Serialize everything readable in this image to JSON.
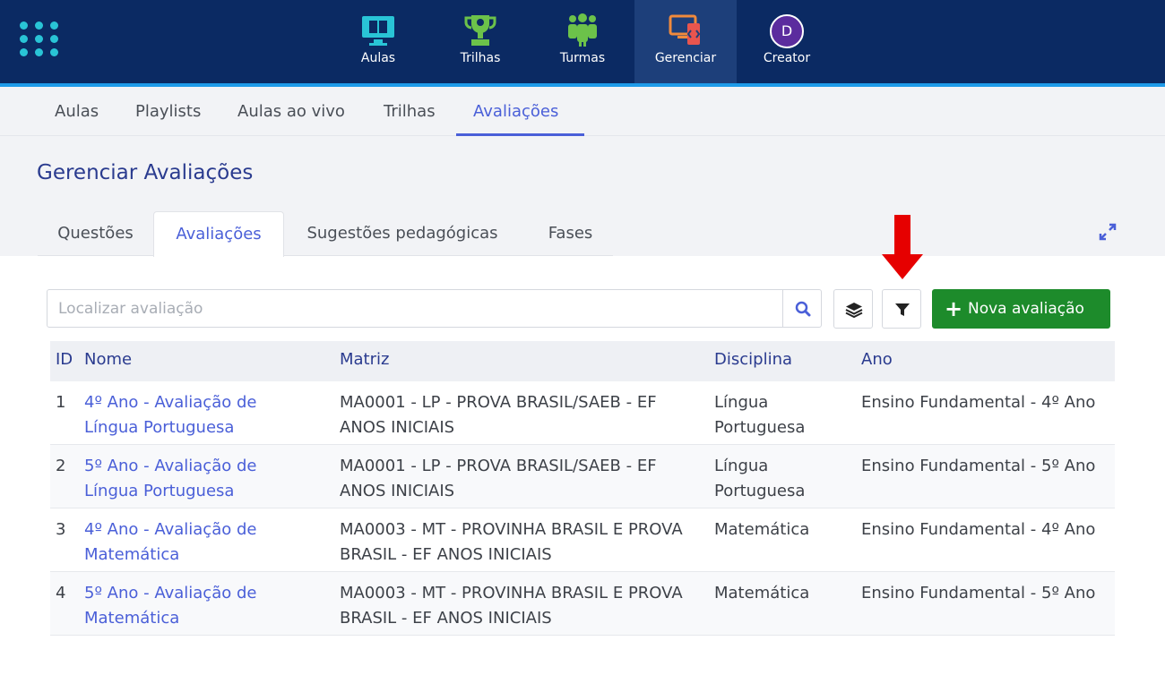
{
  "topnav": {
    "items": [
      {
        "label": "Aulas"
      },
      {
        "label": "Trilhas"
      },
      {
        "label": "Turmas"
      },
      {
        "label": "Gerenciar"
      },
      {
        "label": "Creator",
        "avatar_letter": "D"
      }
    ]
  },
  "subnav": {
    "items": [
      {
        "label": "Aulas"
      },
      {
        "label": "Playlists"
      },
      {
        "label": "Aulas ao vivo"
      },
      {
        "label": "Trilhas"
      },
      {
        "label": "Avaliações"
      }
    ]
  },
  "page": {
    "title": "Gerenciar Avaliações",
    "tabs": [
      {
        "label": "Questões"
      },
      {
        "label": "Avaliações"
      },
      {
        "label": "Sugestões pedagógicas"
      },
      {
        "label": "Fases"
      }
    ]
  },
  "toolbar": {
    "search_placeholder": "Localizar avaliação",
    "new_button_label": "Nova avaliação"
  },
  "table": {
    "headers": {
      "id": "ID",
      "nome": "Nome",
      "matriz": "Matriz",
      "disciplina": "Disciplina",
      "ano": "Ano"
    },
    "rows": [
      {
        "id": "1",
        "nome": "4º Ano - Avaliação de Língua Portuguesa",
        "matriz": "MA0001 - LP - PROVA BRASIL/SAEB - EF ANOS INICIAIS",
        "disciplina": "Língua Portuguesa",
        "ano": "Ensino Fundamental - 4º Ano"
      },
      {
        "id": "2",
        "nome": "5º Ano - Avaliação de Língua Portuguesa",
        "matriz": "MA0001 - LP - PROVA BRASIL/SAEB - EF ANOS INICIAIS",
        "disciplina": "Língua Portuguesa",
        "ano": "Ensino Fundamental - 5º Ano"
      },
      {
        "id": "3",
        "nome": "4º Ano - Avaliação de Matemática",
        "matriz": "MA0003 - MT - PROVINHA BRASIL E PROVA BRASIL - EF ANOS INICIAIS",
        "disciplina": "Matemática",
        "ano": "Ensino Fundamental - 4º Ano"
      },
      {
        "id": "4",
        "nome": "5º Ano - Avaliação de Matemática",
        "matriz": "MA0003 - MT - PROVINHA BRASIL E PROVA BRASIL - EF ANOS INICIAIS",
        "disciplina": "Matemática",
        "ano": "Ensino Fundamental - 5º Ano"
      }
    ]
  },
  "icons": {
    "apps": "grid-dots-icon",
    "aulas": "monitor-book-icon",
    "trilhas": "trophy-icon",
    "turmas": "people-icon",
    "gerenciar": "devices-icon",
    "expand": "expand-arrows-icon",
    "search": "search-icon",
    "layers": "layers-icon",
    "filter": "filter-icon",
    "plus": "plus-icon",
    "annotation": "red-arrow-down"
  },
  "colors": {
    "topbar": "#0b2a63",
    "accent": "#4a5fd8",
    "title": "#2a3b8f",
    "primary_button": "#1d8b2b",
    "annotation_arrow": "#e60000"
  }
}
